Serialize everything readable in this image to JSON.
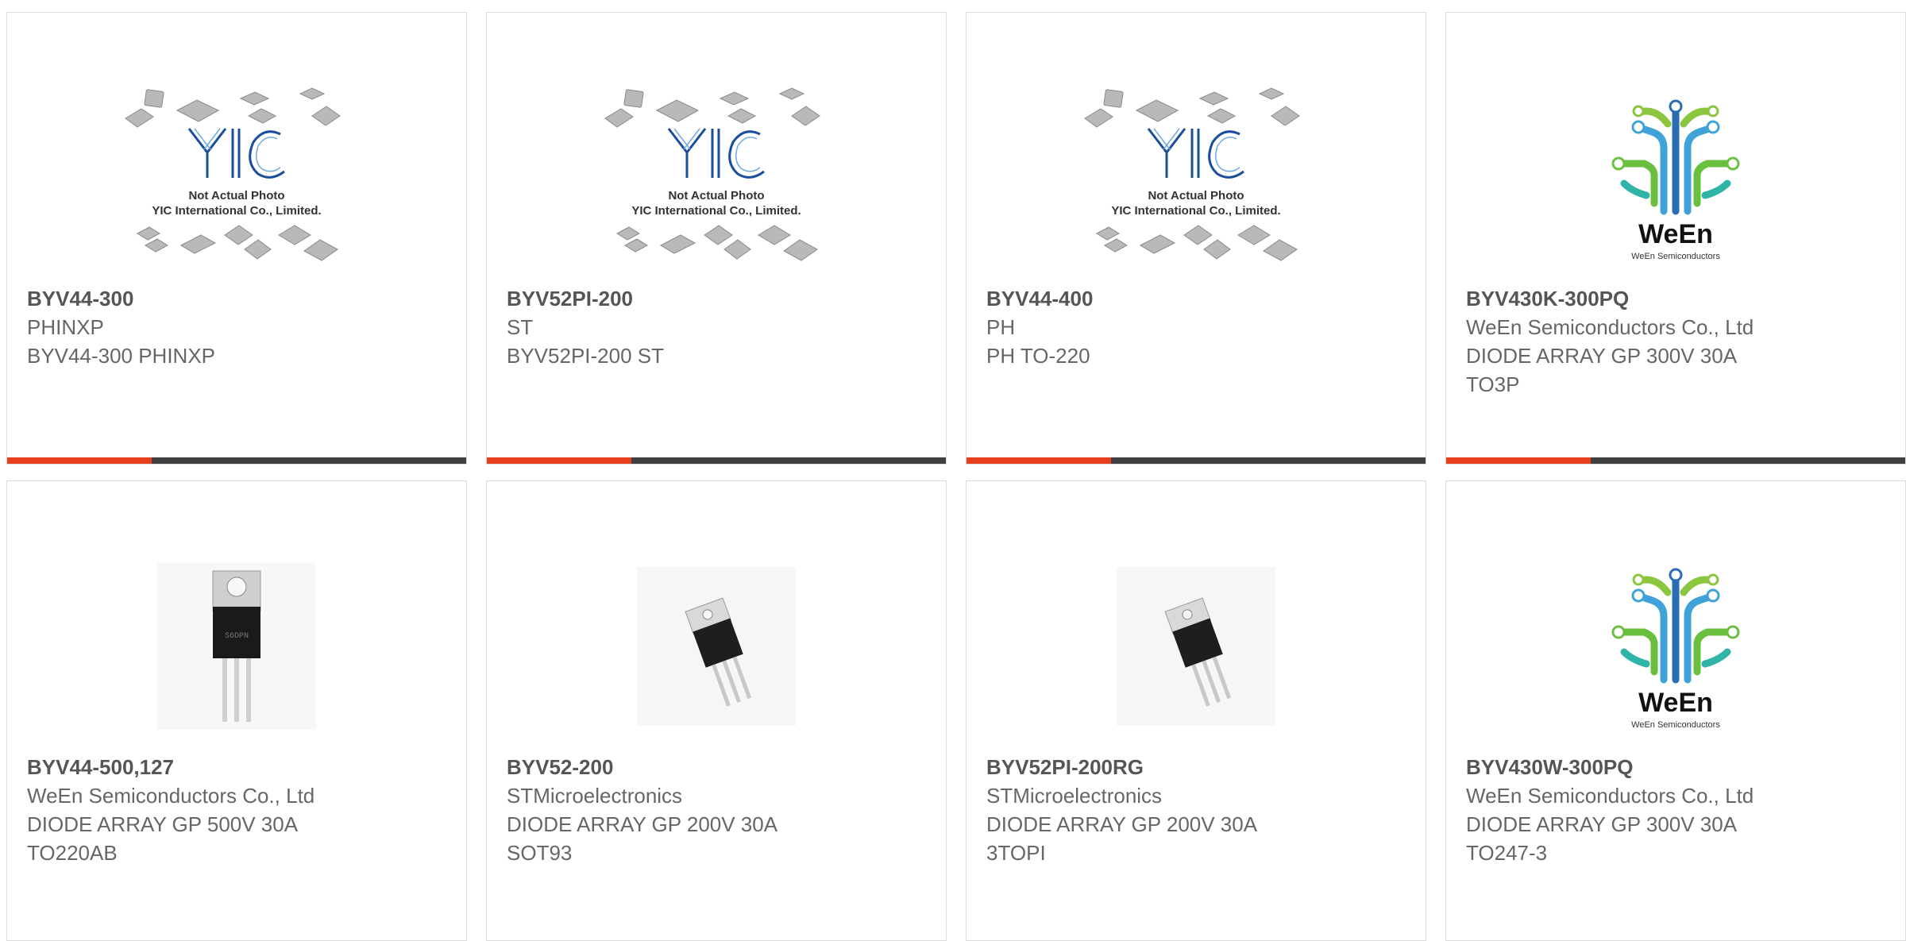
{
  "products": [
    {
      "part_number": "BYV44-300",
      "manufacturer": "PHINXP",
      "description": "BYV44-300 PHINXP",
      "package": "",
      "image": "yic-placeholder",
      "show_bar": true
    },
    {
      "part_number": "BYV52PI-200",
      "manufacturer": "ST",
      "description": "BYV52PI-200 ST",
      "package": "",
      "image": "yic-placeholder",
      "show_bar": true
    },
    {
      "part_number": "BYV44-400",
      "manufacturer": "PH",
      "description": "PH TO-220",
      "package": "",
      "image": "yic-placeholder",
      "show_bar": true
    },
    {
      "part_number": "BYV430K-300PQ",
      "manufacturer": "WeEn Semiconductors Co., Ltd",
      "description": "DIODE ARRAY GP 300V 30A",
      "package": "TO3P",
      "image": "ween-logo",
      "show_bar": true
    },
    {
      "part_number": "BYV44-500,127",
      "manufacturer": "WeEn Semiconductors Co., Ltd",
      "description": "DIODE ARRAY GP 500V 30A",
      "package": "TO220AB",
      "image": "to220-photo",
      "show_bar": false
    },
    {
      "part_number": "BYV52-200",
      "manufacturer": "STMicroelectronics",
      "description": "DIODE ARRAY GP 200V 30A",
      "package": "SOT93",
      "image": "sot93-photo",
      "show_bar": false
    },
    {
      "part_number": "BYV52PI-200RG",
      "manufacturer": "STMicroelectronics",
      "description": "DIODE ARRAY GP 200V 30A",
      "package": "3TOPI",
      "image": "sot93-photo",
      "show_bar": false
    },
    {
      "part_number": "BYV430W-300PQ",
      "manufacturer": "WeEn Semiconductors Co., Ltd",
      "description": "DIODE ARRAY GP 300V 30A",
      "package": "TO247-3",
      "image": "ween-logo",
      "show_bar": false
    }
  ],
  "placeholder": {
    "brand": "YIC",
    "line1": "Not Actual Photo",
    "line2": "YIC International Co., Limited."
  },
  "ween_logo": {
    "name": "WeEn",
    "tagline": "WeEn Semiconductors"
  },
  "to220_marking": "S6DPN",
  "colors": {
    "accent": "#e8401c",
    "bar": "#404040",
    "border": "#dcdcdc",
    "text": "#666666"
  }
}
